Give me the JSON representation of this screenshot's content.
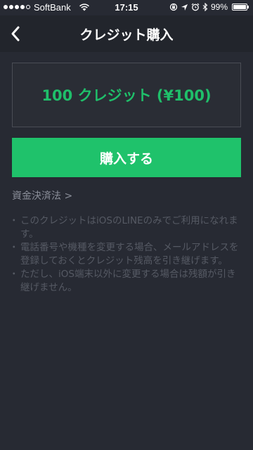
{
  "status_bar": {
    "carrier": "SoftBank",
    "time": "17:15",
    "battery": "99%",
    "battery_level": 0.99,
    "signal_bars": 4,
    "signal_total": 5,
    "icons": [
      "wifi-icon",
      "rotation-lock-icon",
      "location-icon",
      "alarm-icon",
      "bluetooth-icon",
      "battery-icon"
    ]
  },
  "nav": {
    "title": "クレジット購入",
    "back_icon": "chevron-left-icon"
  },
  "credit": {
    "label": "100 クレジット (¥100)"
  },
  "purchase_button": {
    "label": "購入する"
  },
  "payment_link": {
    "label": "資金決済法 >"
  },
  "notes": [
    "このクレジットはiOSのLINEのみでご利用になれます。",
    "電話番号や機種を変更する場合、メールアドレスを登録しておくとクレジット残高を引き継げます。",
    "ただし、iOS端末以外に変更する場合は残額が引き継げません。"
  ],
  "colors": {
    "background": "#272a33",
    "nav_background": "#22252c",
    "accent_green": "#1fc26b",
    "credit_text": "#1fbf6a",
    "note_text": "#565a64",
    "link_text": "#8b8f9a"
  }
}
